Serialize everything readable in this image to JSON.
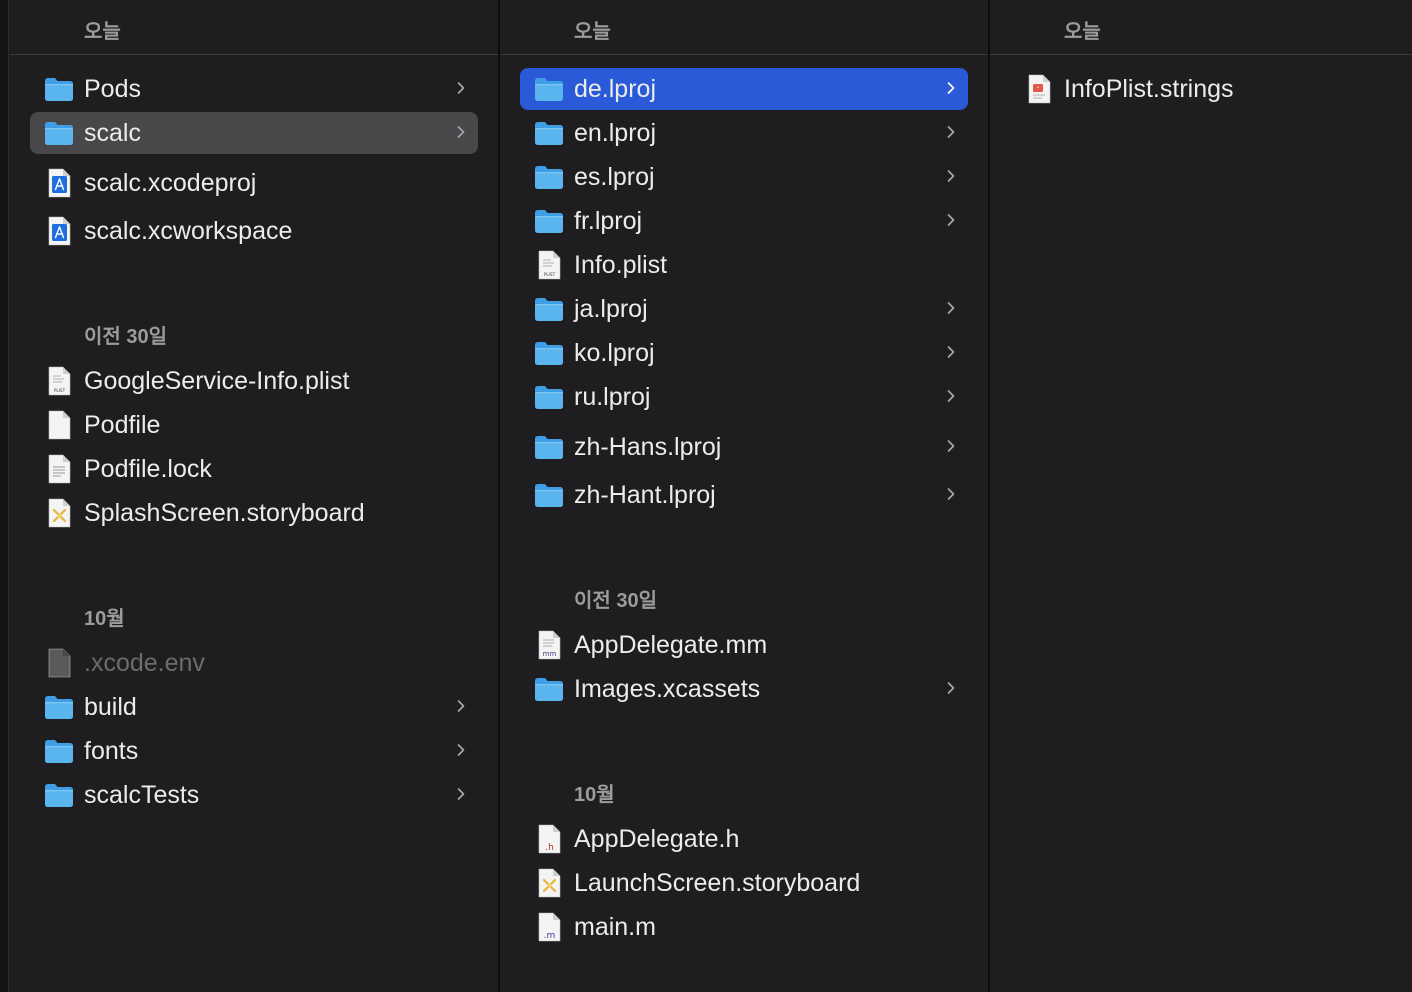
{
  "columns": [
    {
      "header": "오늘",
      "groups": [
        {
          "label": "",
          "items": [
            {
              "name": "Pods",
              "icon": "folder-icon",
              "folder": true,
              "selected": "",
              "dim": false
            },
            {
              "name": "scalc",
              "icon": "folder-icon",
              "folder": true,
              "selected": "gray",
              "dim": false
            },
            {
              "name": "scalc.xcodeproj",
              "icon": "xcodeproj-icon",
              "folder": false,
              "selected": "",
              "dim": false
            },
            {
              "name": "scalc.xcworkspace",
              "icon": "xcworkspace-icon",
              "folder": false,
              "selected": "",
              "dim": false
            }
          ]
        },
        {
          "label": "이전 30일",
          "items": [
            {
              "name": "GoogleService-Info.plist",
              "icon": "plist-file-icon",
              "folder": false,
              "selected": "",
              "dim": false
            },
            {
              "name": "Podfile",
              "icon": "blank-file-icon",
              "folder": false,
              "selected": "",
              "dim": false
            },
            {
              "name": "Podfile.lock",
              "icon": "text-file-icon",
              "folder": false,
              "selected": "",
              "dim": false
            },
            {
              "name": "SplashScreen.storyboard",
              "icon": "storyboard-file-icon",
              "folder": false,
              "selected": "",
              "dim": false
            }
          ]
        },
        {
          "label": "10월",
          "items": [
            {
              "name": ".xcode.env",
              "icon": "hidden-file-icon",
              "folder": false,
              "selected": "",
              "dim": true
            },
            {
              "name": "build",
              "icon": "folder-icon",
              "folder": true,
              "selected": "",
              "dim": false
            },
            {
              "name": "fonts",
              "icon": "folder-icon",
              "folder": true,
              "selected": "",
              "dim": false
            },
            {
              "name": "scalcTests",
              "icon": "folder-icon",
              "folder": true,
              "selected": "",
              "dim": false
            }
          ]
        }
      ]
    },
    {
      "header": "오늘",
      "groups": [
        {
          "label": "",
          "items": [
            {
              "name": "de.lproj",
              "icon": "folder-icon",
              "folder": true,
              "selected": "blue",
              "dim": false
            },
            {
              "name": "en.lproj",
              "icon": "folder-icon",
              "folder": true,
              "selected": "",
              "dim": false
            },
            {
              "name": "es.lproj",
              "icon": "folder-icon",
              "folder": true,
              "selected": "",
              "dim": false
            },
            {
              "name": "fr.lproj",
              "icon": "folder-icon",
              "folder": true,
              "selected": "",
              "dim": false
            },
            {
              "name": "Info.plist",
              "icon": "plist-file-icon",
              "folder": false,
              "selected": "",
              "dim": false
            },
            {
              "name": "ja.lproj",
              "icon": "folder-icon",
              "folder": true,
              "selected": "",
              "dim": false
            },
            {
              "name": "ko.lproj",
              "icon": "folder-icon",
              "folder": true,
              "selected": "",
              "dim": false
            },
            {
              "name": "ru.lproj",
              "icon": "folder-icon",
              "folder": true,
              "selected": "",
              "dim": false
            },
            {
              "name": "zh-Hans.lproj",
              "icon": "folder-icon",
              "folder": true,
              "selected": "",
              "dim": false
            },
            {
              "name": "zh-Hant.lproj",
              "icon": "folder-icon",
              "folder": true,
              "selected": "",
              "dim": false
            }
          ]
        },
        {
          "label": "이전 30일",
          "items": [
            {
              "name": "AppDelegate.mm",
              "icon": "mm-file-icon",
              "folder": false,
              "selected": "",
              "dim": false
            },
            {
              "name": "Images.xcassets",
              "icon": "folder-icon",
              "folder": true,
              "selected": "",
              "dim": false
            }
          ]
        },
        {
          "label": "10월",
          "items": [
            {
              "name": "AppDelegate.h",
              "icon": "h-file-icon",
              "folder": false,
              "selected": "",
              "dim": false
            },
            {
              "name": "LaunchScreen.storyboard",
              "icon": "storyboard-file-icon",
              "folder": false,
              "selected": "",
              "dim": false
            },
            {
              "name": "main.m",
              "icon": "m-file-icon",
              "folder": false,
              "selected": "",
              "dim": false
            }
          ]
        }
      ]
    },
    {
      "header": "오늘",
      "groups": [
        {
          "label": "",
          "items": [
            {
              "name": "InfoPlist.strings",
              "icon": "strings-file-icon",
              "folder": false,
              "selected": "",
              "dim": false
            }
          ]
        }
      ]
    }
  ],
  "colors": {
    "background": "#1e1e20",
    "selection_active": "#2a5ad7",
    "selection_inactive": "#48484b",
    "folder": "#5ab4ee"
  }
}
